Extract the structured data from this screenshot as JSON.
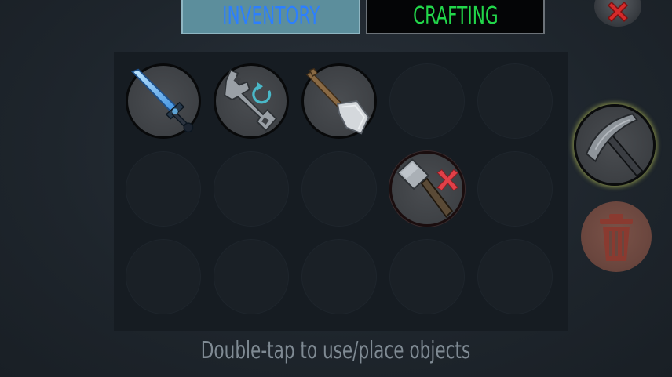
{
  "tabs": {
    "inventory_label": "INVENTORY",
    "crafting_label": "CRAFTING"
  },
  "colors": {
    "inventory_tab_bg": "#5c8e9c",
    "inventory_tab_text": "#2c7fff",
    "crafting_tab_bg": "#040506",
    "crafting_tab_text": "#22d64a",
    "close_x": "#d42a2a",
    "trash": "#8a3a30",
    "equipped_glow": "#c8d25a",
    "hint_text": "#7f8a93"
  },
  "inventory": {
    "rows": 3,
    "columns": 5,
    "items": [
      {
        "slot": 1,
        "icon": "sword-icon",
        "name": "Glowing Blue Sword"
      },
      {
        "slot": 2,
        "icon": "wrench-icon",
        "name": "Wrench",
        "badge": "cycle-arrow-icon"
      },
      {
        "slot": 3,
        "icon": "shovel-icon",
        "name": "Shovel"
      },
      {
        "slot": 9,
        "icon": "hammer-icon",
        "name": "Hammer",
        "badge": "red-x-icon"
      }
    ]
  },
  "equipped": {
    "icon": "pickaxe-icon",
    "name": "Pickaxe"
  },
  "close_icon": "close-icon",
  "trash_icon": "trash-icon",
  "hint": "Double-tap to use/place objects"
}
